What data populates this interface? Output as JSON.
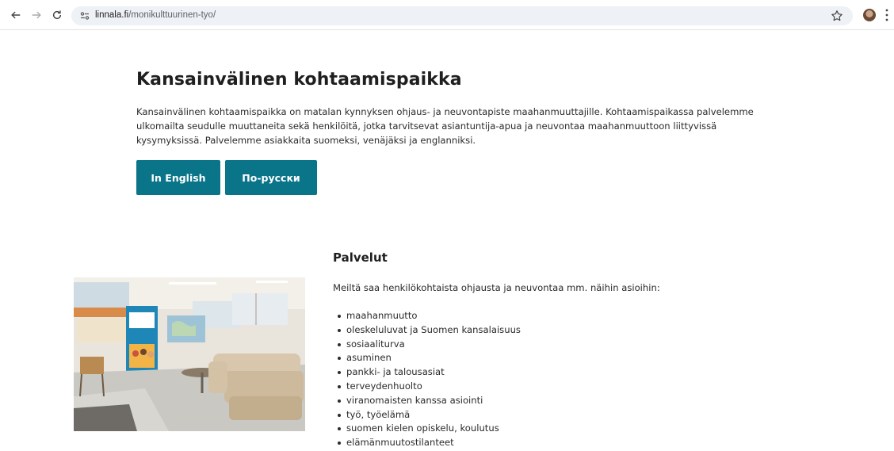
{
  "browser": {
    "url_domain": "linnala.fi",
    "url_path": "/monikulttuurinen-tyo/",
    "icons": [
      "back-arrow-icon",
      "forward-arrow-icon",
      "reload-icon",
      "site-settings-icon",
      "bookmark-star-icon",
      "profile-avatar",
      "more-menu-icon"
    ]
  },
  "page": {
    "title": "Kansainvälinen kohtaamispaikka",
    "intro": "Kansainvälinen kohtaamispaikka on matalan kynnyksen ohjaus- ja neuvontapiste maahanmuuttajille. Kohtaamispaikassa palvelemme ulkomailta seudulle muuttaneita sekä henkilöitä, jotka tarvitsevat asiantuntija-apua ja neuvontaa maahanmuuttoon liittyvissä kysymyksissä. Palvelemme asiakkaita suomeksi, venäjäksi ja englanniksi.",
    "buttons": {
      "english": "In English",
      "russian": "По-русски"
    },
    "accent_color": "#0a7489"
  },
  "services": {
    "title": "Palvelut",
    "intro": "Meiltä saa henkilökohtaista ohjausta ja neuvontaa mm. näihin asioihin:",
    "items": [
      "maahanmuutto",
      "oleskeluluvat ja Suomen kansalaisuus",
      "sosiaaliturva",
      "asuminen",
      "pankki- ja talousasiat",
      "terveydenhuolto",
      "viranomaisten kanssa asiointi",
      "työ, työelämä",
      "suomen kielen opiskelu, koulutus",
      "elämänmuutostilanteet"
    ]
  }
}
